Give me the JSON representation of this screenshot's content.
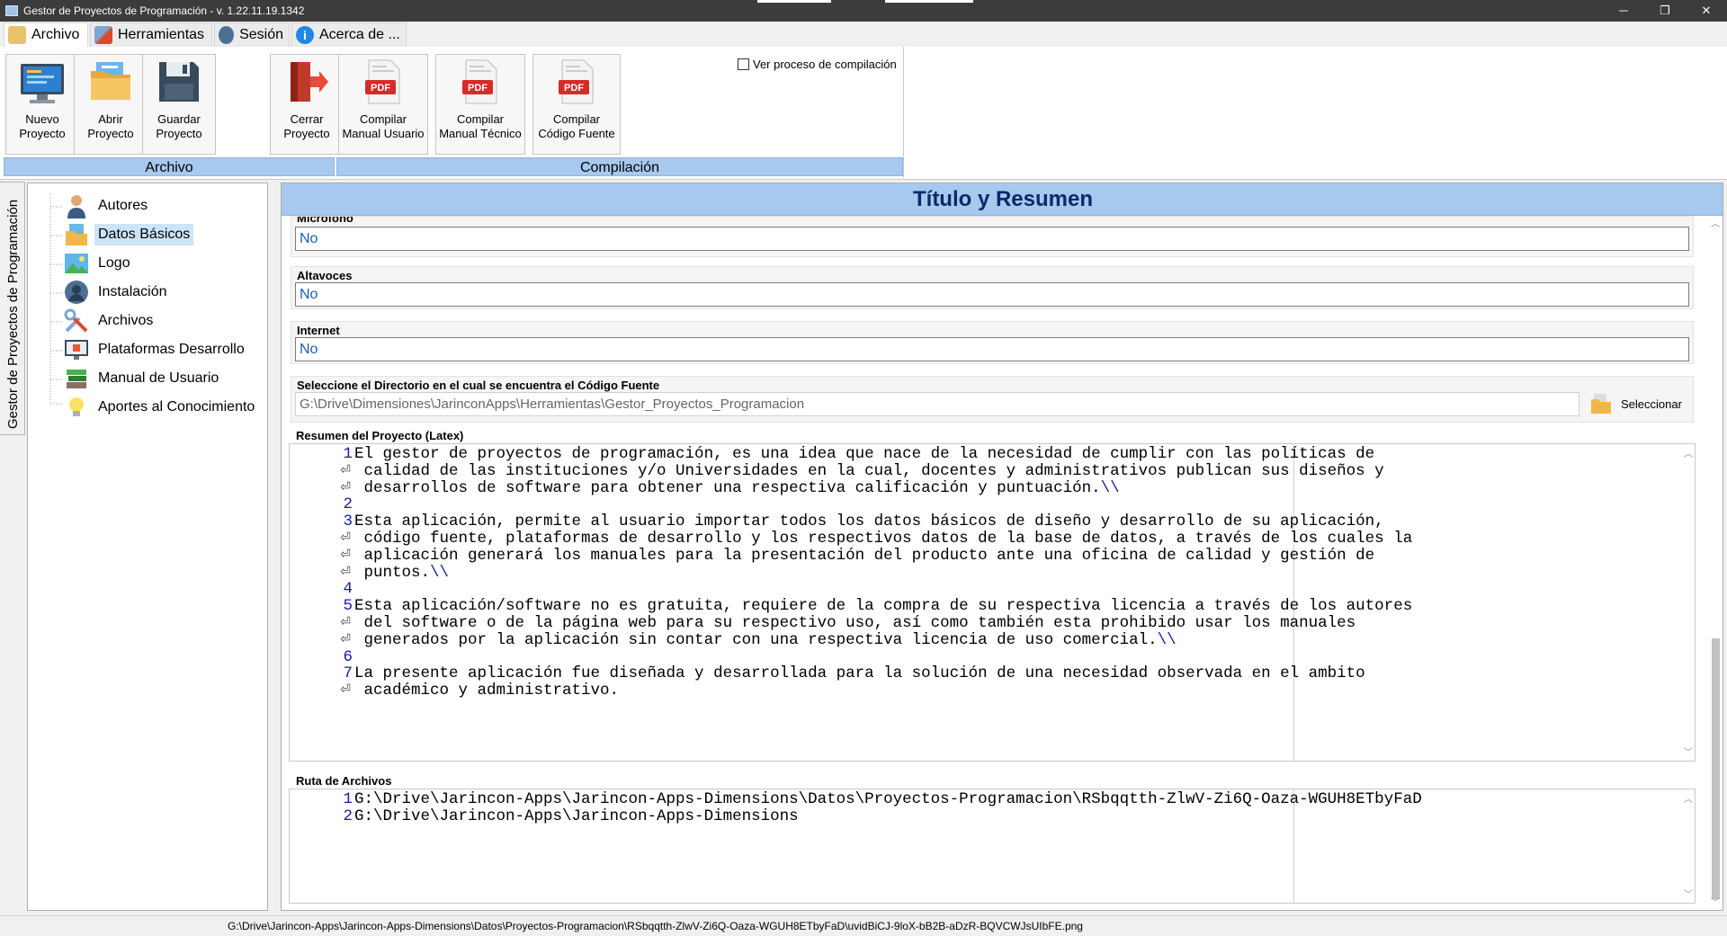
{
  "window": {
    "title": "Gestor de Proyectos de Programación - v. 1.22.11.19.1342",
    "minimize": "─",
    "maximize": "❐",
    "close": "✕"
  },
  "menu": {
    "items": [
      {
        "label": "Archivo",
        "icon": "folder-icon"
      },
      {
        "label": "Herramientas",
        "icon": "tools-icon"
      },
      {
        "label": "Sesión",
        "icon": "user-icon"
      },
      {
        "label": "Acerca de ...",
        "icon": "info-icon"
      }
    ]
  },
  "ribbon": {
    "buttons": [
      {
        "line1": "Nuevo",
        "line2": "Proyecto",
        "icon": "new-project-icon"
      },
      {
        "line1": "Abrir",
        "line2": "Proyecto",
        "icon": "open-folder-icon"
      },
      {
        "line1": "Guardar",
        "line2": "Proyecto",
        "icon": "save-icon"
      },
      {
        "line1": "Cerrar",
        "line2": "Proyecto",
        "icon": "exit-door-icon"
      },
      {
        "line1": "Compilar",
        "line2": "Manual Usuario",
        "icon": "pdf-icon"
      },
      {
        "line1": "Compilar",
        "line2": "Manual Técnico",
        "icon": "pdf-icon"
      },
      {
        "line1": "Compilar",
        "line2": "Código Fuente",
        "icon": "pdf-icon"
      }
    ],
    "groups": {
      "archivo": "Archivo",
      "compilacion": "Compilación"
    },
    "checkbox_label": "Ver proceso de compilación",
    "checkbox_checked": false
  },
  "side_tab": {
    "label": "Gestor de Proyectos de Programación"
  },
  "tree": {
    "items": [
      {
        "label": "Autores",
        "icon": "person-icon"
      },
      {
        "label": "Datos Básicos",
        "icon": "folder-docs-icon",
        "selected": true
      },
      {
        "label": "Logo",
        "icon": "image-icon"
      },
      {
        "label": "Instalación",
        "icon": "user-install-icon"
      },
      {
        "label": "Archivos",
        "icon": "tools-icon"
      },
      {
        "label": "Plataformas Desarrollo",
        "icon": "monitor-icon"
      },
      {
        "label": "Manual de Usuario",
        "icon": "books-icon"
      },
      {
        "label": "Aportes al Conocimiento",
        "icon": "lightbulb-icon"
      }
    ]
  },
  "main": {
    "header": "Título y Resumen",
    "fields": [
      {
        "label": "Micrófono",
        "value": "No"
      },
      {
        "label": "Altavoces",
        "value": "No"
      },
      {
        "label": "Internet",
        "value": "No"
      }
    ],
    "directory": {
      "label": "Seleccione el Directorio en el cual se encuentra el Código Fuente",
      "value": "G:\\Drive\\Dimensiones\\JarinconApps\\Herramientas\\Gestor_Proyectos_Programacion",
      "button": "Seleccionar"
    },
    "summary": {
      "label": "Resumen del Proyecto (Latex)",
      "lines": [
        {
          "num": "1",
          "text": "El gestor de proyectos de programación, es una idea que nace de la necesidad de cumplir con las políticas de",
          "bs": ""
        },
        {
          "num": "",
          "text": " calidad de las instituciones y/o Universidades en la cual, docentes y administrativos publican sus diseños y",
          "bs": ""
        },
        {
          "num": "",
          "text": " desarrollos de software para obtener una respectiva calificación y puntuación.",
          "bs": "\\\\"
        },
        {
          "num": "2",
          "text": "",
          "bs": ""
        },
        {
          "num": "3",
          "text": "Esta aplicación, permite al usuario importar todos los datos básicos de diseño y desarrollo de su aplicación,",
          "bs": ""
        },
        {
          "num": "",
          "text": " código fuente, plataformas de desarrollo y los respectivos datos de la base de datos, a través de los cuales la",
          "bs": ""
        },
        {
          "num": "",
          "text": " aplicación generará los manuales para la presentación del producto ante una oficina de calidad y gestión de",
          "bs": ""
        },
        {
          "num": "",
          "text": " puntos.",
          "bs": "\\\\"
        },
        {
          "num": "4",
          "text": "",
          "bs": ""
        },
        {
          "num": "5",
          "text": "Esta aplicación/software no es gratuita, requiere de la compra de su respectiva licencia a través de los autores",
          "bs": ""
        },
        {
          "num": "",
          "text": " del software o de la página web para su respectivo uso, así como también esta prohibido usar los manuales",
          "bs": ""
        },
        {
          "num": "",
          "text": " generados por la aplicación sin contar con una respectiva licencia de uso comercial.",
          "bs": "\\\\"
        },
        {
          "num": "6",
          "text": "",
          "bs": ""
        },
        {
          "num": "7",
          "text": "La presente aplicación fue diseñada y desarrollada para la solución de una necesidad observada en el ambito",
          "bs": ""
        },
        {
          "num": "",
          "text": " académico y administrativo.",
          "bs": ""
        }
      ]
    },
    "routes": {
      "label": "Ruta de Archivos",
      "lines": [
        {
          "num": "1",
          "text": "G:\\Drive\\Jarincon-Apps\\Jarincon-Apps-Dimensions\\Datos\\Proyectos-Programacion\\RSbqqtth-ZlwV-Zi6Q-Oaza-WGUH8ETbyFaD"
        },
        {
          "num": "2",
          "text": "G:\\Drive\\Jarincon-Apps\\Jarincon-Apps-Dimensions"
        }
      ]
    }
  },
  "status": {
    "path": "G:\\Drive\\Jarincon-Apps\\Jarincon-Apps-Dimensions\\Datos\\Proyectos-Programacion\\RSbqqtth-ZlwV-Zi6Q-Oaza-WGUH8ETbyFaD\\uvidBiCJ-9loX-bB2B-aDzR-BQVCWJsUIbFE.png"
  }
}
